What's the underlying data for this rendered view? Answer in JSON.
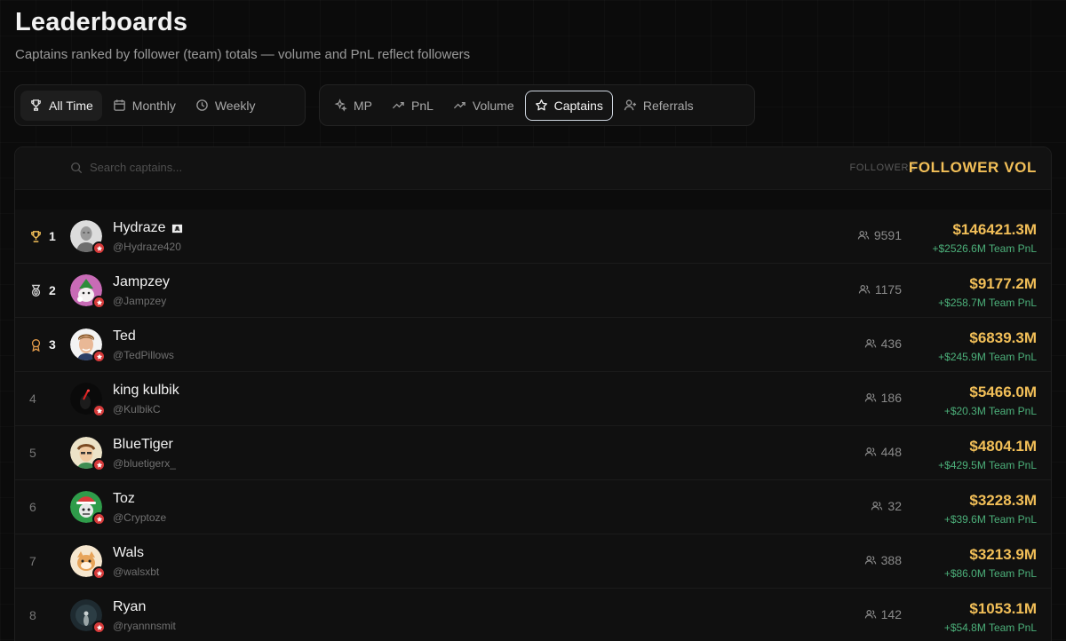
{
  "page": {
    "title": "Leaderboards",
    "subtitle": "Captains ranked by follower (team) totals — volume and PnL reflect followers"
  },
  "period_tabs": [
    {
      "label": "All Time",
      "icon": "trophy-icon",
      "active": true
    },
    {
      "label": "Monthly",
      "icon": "calendar-icon",
      "active": false
    },
    {
      "label": "Weekly",
      "icon": "clock-icon",
      "active": false
    }
  ],
  "metric_tabs": [
    {
      "label": "MP",
      "icon": "sparkle-icon",
      "active": false
    },
    {
      "label": "PnL",
      "icon": "trending-up-icon",
      "active": false
    },
    {
      "label": "Volume",
      "icon": "trending-up-icon",
      "active": false
    },
    {
      "label": "Captains",
      "icon": "star-icon",
      "active": true
    },
    {
      "label": "Referrals",
      "icon": "user-plus-icon",
      "active": false
    }
  ],
  "table": {
    "search_placeholder": "Search captains...",
    "columns": {
      "followers": "FOLLOWERS",
      "follower_vol": "FOLLOWER VOL"
    },
    "rows": [
      {
        "rank": "1",
        "name": "Hydraze",
        "handle": "@Hydraze420",
        "followers": "9591",
        "volume": "$146421.3M",
        "pnl": "+$2526.6M Team PnL"
      },
      {
        "rank": "2",
        "name": "Jampzey",
        "handle": "@Jampzey",
        "followers": "1175",
        "volume": "$9177.2M",
        "pnl": "+$258.7M Team PnL"
      },
      {
        "rank": "3",
        "name": "Ted",
        "handle": "@TedPillows",
        "followers": "436",
        "volume": "$6839.3M",
        "pnl": "+$245.9M Team PnL"
      },
      {
        "rank": "4",
        "name": "king kulbik",
        "handle": "@KulbikC",
        "followers": "186",
        "volume": "$5466.0M",
        "pnl": "+$20.3M Team PnL"
      },
      {
        "rank": "5",
        "name": "BlueTiger",
        "handle": "@bluetigerx_",
        "followers": "448",
        "volume": "$4804.1M",
        "pnl": "+$429.5M Team PnL"
      },
      {
        "rank": "6",
        "name": "Toz",
        "handle": "@Cryptoze",
        "followers": "32",
        "volume": "$3228.3M",
        "pnl": "+$39.6M Team PnL"
      },
      {
        "rank": "7",
        "name": "Wals",
        "handle": "@walsxbt",
        "followers": "388",
        "volume": "$3213.9M",
        "pnl": "+$86.0M Team PnL"
      },
      {
        "rank": "8",
        "name": "Ryan",
        "handle": "@ryannnsmit",
        "followers": "142",
        "volume": "$1053.1M",
        "pnl": "+$54.8M Team PnL"
      }
    ]
  },
  "colors": {
    "volume": "#f2bf58",
    "pnl": "#4cb07a",
    "badge": "#d63a3a",
    "gold": "#f2bf58",
    "silver": "#d0d0d0",
    "bronze": "#e39b4a"
  }
}
